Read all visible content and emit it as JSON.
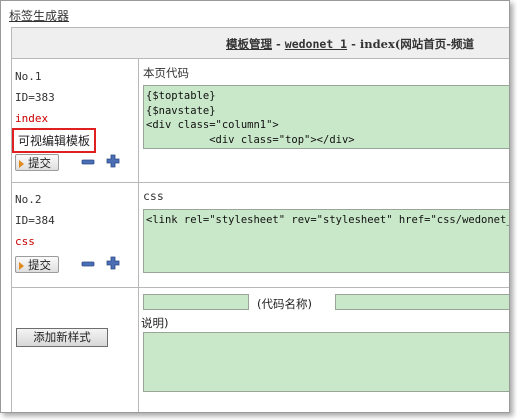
{
  "top_link": "标签生成器",
  "breadcrumb": {
    "part1": "模板管理",
    "sep1": " - ",
    "part2": "wedonet 1",
    "sep2": " - ",
    "part3": "index(网站首页-频道"
  },
  "templates": [
    {
      "no": "No.1",
      "id": "ID=383",
      "name": "index",
      "visual_edit": "可视编辑模板",
      "submit": "提交",
      "section_label": "本页代码",
      "code": "{$toptable}\n{$navstate}\n<div class=\"column1\">\n          <div class=\"top\"></div>"
    },
    {
      "no": "No.2",
      "id": "ID=384",
      "name": "css",
      "submit": "提交",
      "section_label": "css",
      "code": "<link rel=\"stylesheet\" rev=\"stylesheet\" href=\"css/wedonet_all"
    }
  ],
  "new_style": {
    "add_button": "添加新样式",
    "code_name_label": "(代码名称)",
    "desc_label": "说明)"
  },
  "colors": {
    "code_bg": "#c9e7c9",
    "highlight_border": "#e02020",
    "accent_red": "#cc0000"
  },
  "icons": {
    "remove": "minus-icon",
    "add": "plus-icon",
    "submit_arrow": "arrow-right-icon"
  }
}
